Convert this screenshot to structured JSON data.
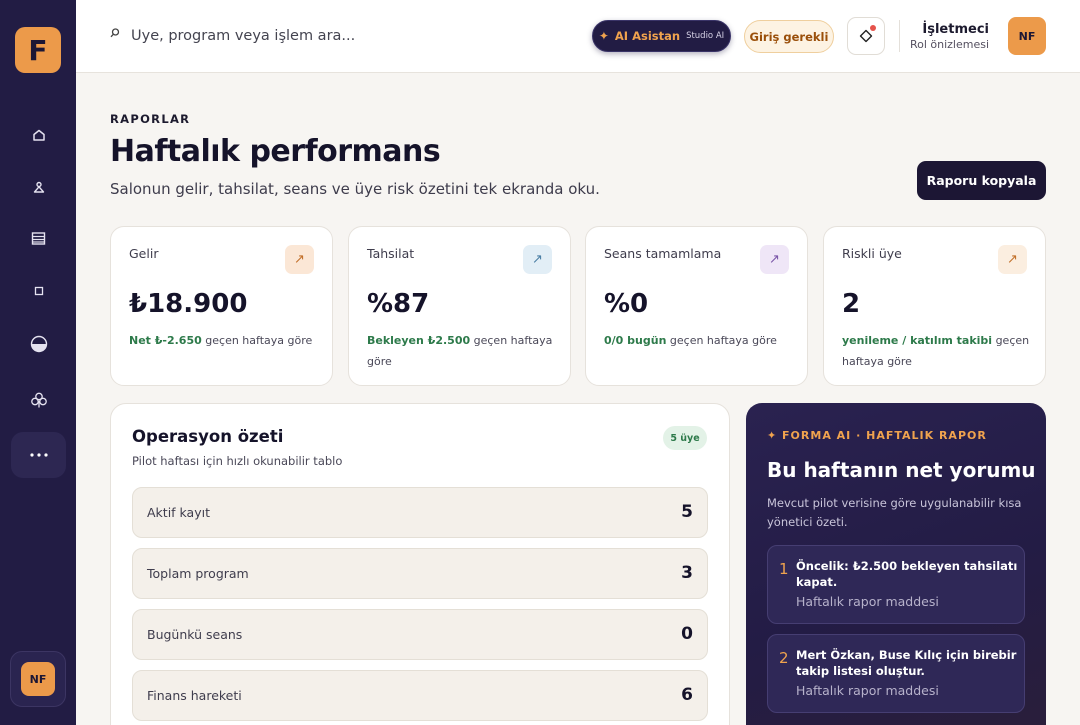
{
  "brand": {
    "logo_letter": "F"
  },
  "sidebar": {
    "items": [
      {
        "name": "home",
        "icon": "home-icon"
      },
      {
        "name": "members",
        "icon": "person-icon"
      },
      {
        "name": "calendar",
        "icon": "calendar-icon"
      },
      {
        "name": "programs",
        "icon": "square-icon"
      },
      {
        "name": "reports",
        "icon": "half-circle-icon"
      },
      {
        "name": "community",
        "icon": "club-icon"
      },
      {
        "name": "more",
        "icon": "more-icon",
        "active": true
      }
    ],
    "avatar_initials": "NF"
  },
  "topbar": {
    "search_placeholder": "Üye, program veya işlem ara...",
    "ai_button_label": "AI Asistan",
    "ai_button_sub": "Studio AI",
    "ai_button_star": "✦",
    "login_label": "Giriş gerekli",
    "user_name": "İşletmeci",
    "user_role": "Rol önizlemesi",
    "avatar_initials": "NF"
  },
  "header": {
    "eyebrow": "RAPORLAR",
    "title": "Haftalık performans",
    "subtitle": "Salonun gelir, tahsilat, seans ve üye risk özetini tek ekranda oku.",
    "copy_button": "Raporu kopyala"
  },
  "kpis": [
    {
      "label": "Gelir",
      "value": "₺18.900",
      "highlight": "Net ₺-2.650",
      "note": " geçen haftaya göre",
      "badge_bg": "#fbe7d6",
      "badge_color": "#c2702a"
    },
    {
      "label": "Tahsilat",
      "value": "%87",
      "highlight": "Bekleyen ₺2.500",
      "note": " geçen haftaya göre",
      "badge_bg": "#e2eef6",
      "badge_color": "#4a7ea4"
    },
    {
      "label": "Seans tamamlama",
      "value": "%0",
      "highlight": "0/0 bugün",
      "note": " geçen haftaya göre",
      "badge_bg": "#efe6f7",
      "badge_color": "#7a55a8"
    },
    {
      "label": "Riskli üye",
      "value": "2",
      "highlight": "yenileme / katılım takibi",
      "note": " geçen haftaya göre",
      "badge_bg": "#fbeee0",
      "badge_color": "#c2702a"
    }
  ],
  "kpi_arrow": "↗",
  "operations": {
    "title": "Operasyon özeti",
    "subtitle": "Pilot haftası için hızlı okunabilir tablo",
    "pill": "5 üye",
    "rows": [
      {
        "label": "Aktif kayıt",
        "value": "5"
      },
      {
        "label": "Toplam program",
        "value": "3"
      },
      {
        "label": "Bugünkü seans",
        "value": "0"
      },
      {
        "label": "Finans hareketi",
        "value": "6"
      }
    ]
  },
  "ai_report": {
    "eyebrow": "✦ FORMA AI · HAFTALIK RAPOR",
    "title": "Bu haftanın net yorumu",
    "description": "Mevcut pilot verisine göre uygulanabilir kısa yönetici özeti.",
    "items": [
      {
        "num": "1",
        "text": "Öncelik: ₺2.500 bekleyen tahsilatı kapat.",
        "meta": "Haftalık rapor maddesi"
      },
      {
        "num": "2",
        "text": "Mert Özkan, Buse Kılıç için birebir takip listesi oluştur.",
        "meta": "Haftalık rapor maddesi"
      }
    ]
  }
}
